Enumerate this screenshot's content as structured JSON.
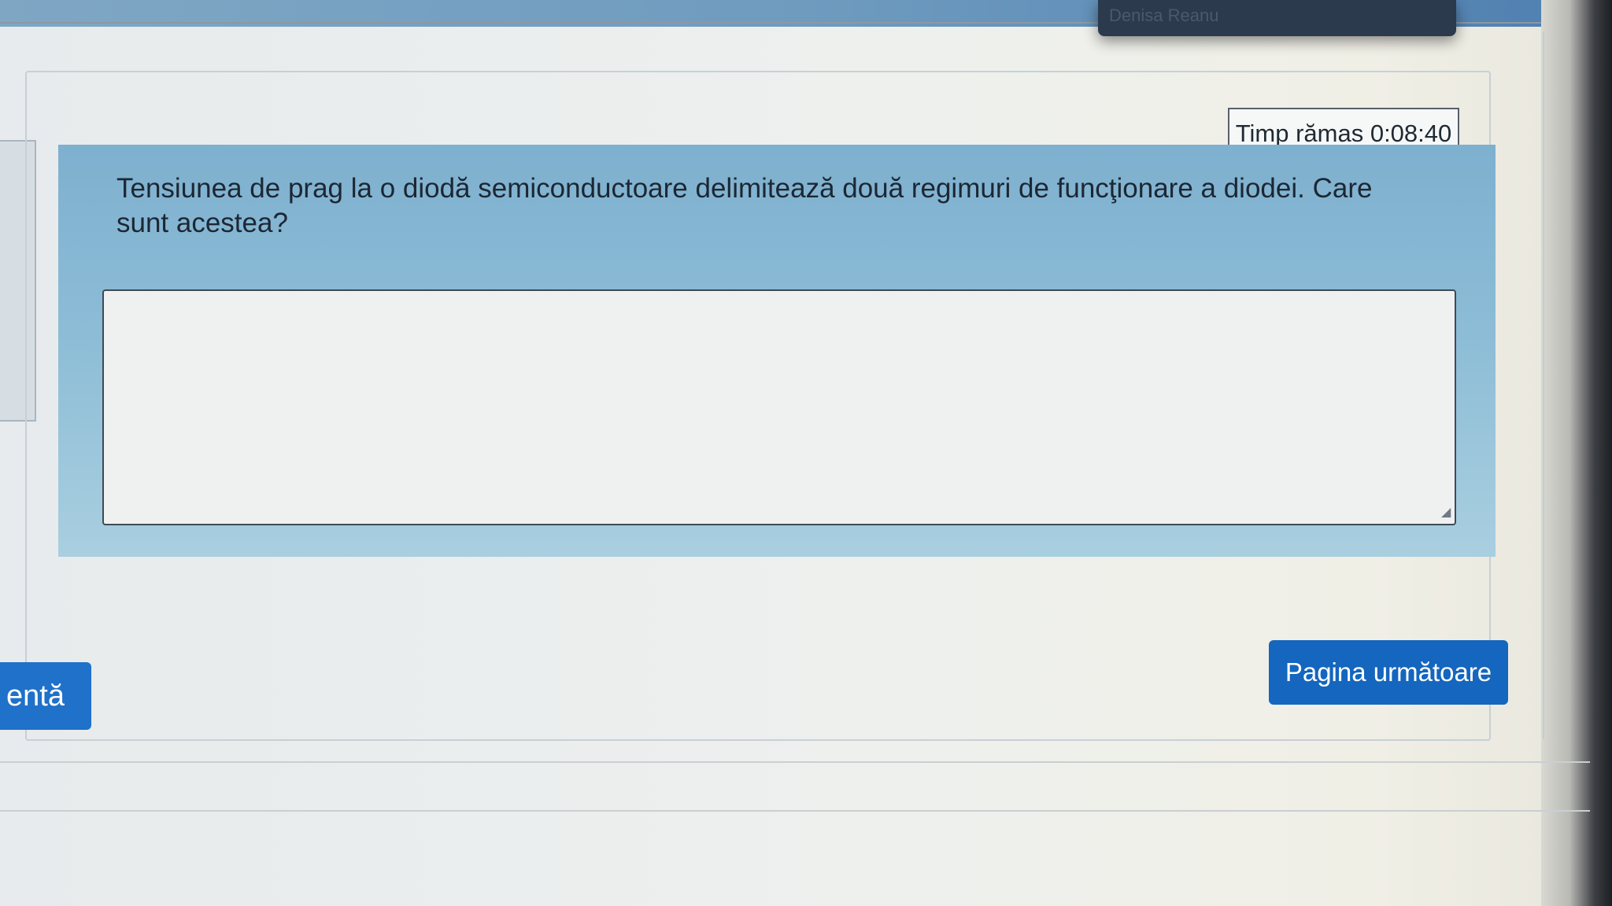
{
  "header": {
    "user_name": "Denisa Reanu"
  },
  "quiz": {
    "timer_text": "Timp rămas 0:08:40",
    "question_text": "Tensiunea de prag la o diodă semiconductoare  delimitează două regimuri de funcţionare a diodei. Care sunt acestea?",
    "answer_value": ""
  },
  "navigation": {
    "prev_label": "entă",
    "next_label": "Pagina următoare"
  }
}
